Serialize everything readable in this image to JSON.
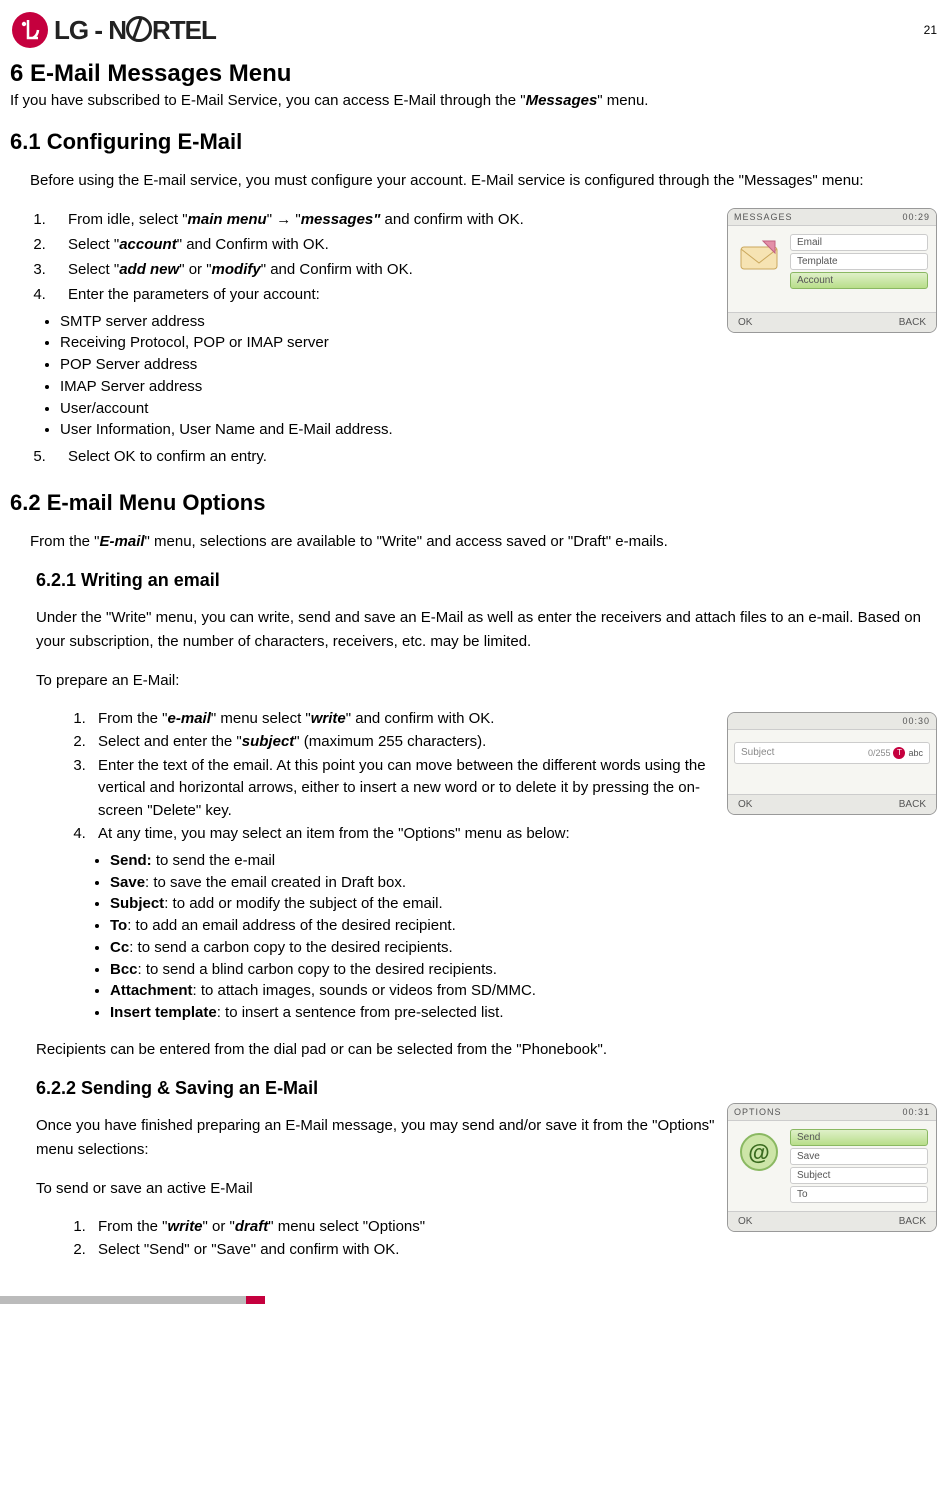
{
  "page_number": "21",
  "logo_text": "LG - NORTEL",
  "h1": "6   E-Mail Messages Menu",
  "intro_1a": "If you have subscribed to E-Mail Service, you can access E-Mail through the \"",
  "intro_1b": "Messages",
  "intro_1c": "\" menu.",
  "h2_61": "6.1     Configuring E-Mail",
  "p61": "Before using the E-mail service, you must configure your account.  E-Mail service is configured through the \"Messages\" menu:",
  "ol61": {
    "li1a": "From idle, select \"",
    "li1b": "main menu",
    "li1c": "\" → \"",
    "li1d": "messages\"",
    "li1e": " and confirm with OK.",
    "li2a": "Select \"",
    "li2b": "account",
    "li2c": "\" and Confirm with OK.",
    "li3a": "Select \"",
    "li3b": "add new",
    "li3c": "\" or \"",
    "li3d": "modify",
    "li3e": "\" and Confirm with OK.",
    "li4": "Enter the parameters of your account:",
    "li5": "Select OK to confirm an entry."
  },
  "ul61": [
    "SMTP server address",
    "Receiving Protocol, POP or IMAP server",
    "POP Server address",
    "IMAP Server address",
    "User/account",
    "User Information, User Name and E-Mail address."
  ],
  "screen1": {
    "title": "MESSAGES",
    "time": "00:29",
    "items": [
      "Email",
      "Template",
      "Account"
    ],
    "selected": 2,
    "ok": "OK",
    "back": "BACK"
  },
  "h2_62": "6.2     E-mail Menu Options",
  "p62a": "From the \"",
  "p62b": "E-mail",
  "p62c": "\" menu, selections are available to \"Write\" and access saved or \"Draft\" e-mails.",
  "h3_621": "6.2.1    Writing an email",
  "p621_1": "Under the \"Write\" menu, you can write, send and save an E-Mail as well as enter the receivers and attach files to an e-mail.  Based on your subscription, the number of characters, receivers, etc. may be limited.",
  "p621_2": "To prepare an E-Mail:",
  "ol621": {
    "li1a": "From the \"",
    "li1b": "e-mail",
    "li1c": "\" menu select \"",
    "li1d": "write",
    "li1e": "\" and confirm with OK.",
    "li2a": "Select and enter the \"",
    "li2b": "subject",
    "li2c": "\" (maximum 255 characters).",
    "li3": "Enter the text of the email. At this point you can move between the different words using the vertical and horizontal arrows, either to insert a new word or to delete it by pressing the on-screen \"Delete\" key.",
    "li4": "At any time, you may select an item from the \"Options\" menu as below:"
  },
  "ul621": [
    {
      "b": "Send:",
      "t": " to send the e-mail"
    },
    {
      "b": "Save",
      "t": ": to save the email created in Draft box."
    },
    {
      "b": "Subject",
      "t": ": to add or modify the subject of the email."
    },
    {
      "b": "To",
      "t": ": to add an email address of the desired recipient."
    },
    {
      "b": "Cc",
      "t": ": to send a carbon copy to the desired recipients."
    },
    {
      "b": "Bcc",
      "t": ": to send a blind carbon copy to the desired recipients."
    },
    {
      "b": "Attachment",
      "t": ": to attach images, sounds or videos from SD/MMC."
    },
    {
      "b": "Insert template",
      "t": ": to insert a sentence from pre-selected list."
    }
  ],
  "screen2": {
    "title": "",
    "time": "00:30",
    "subject_label": "Subject",
    "counter": "0/255",
    "mode": "abc",
    "ok": "OK",
    "back": "BACK"
  },
  "p621_3": "Recipients can be entered from the dial pad or can be selected from the \"Phonebook\".",
  "h3_622": "6.2.2    Sending & Saving an E-Mail",
  "p622_1": "Once you have finished preparing an E-Mail message, you may send and/or save it from the \"Options\" menu selections:",
  "p622_2": "To send or save an active E-Mail",
  "ol622": {
    "li1a": "From the \"",
    "li1b": "write",
    "li1c": "\" or \"",
    "li1d": "draft",
    "li1e": "\" menu select \"Options\"",
    "li2": "Select \"Send\" or \"Save\" and confirm with OK."
  },
  "screen3": {
    "title": "OPTIONS",
    "time": "00:31",
    "items": [
      "Send",
      "Save",
      "Subject",
      "To"
    ],
    "selected": 0,
    "ok": "OK",
    "back": "BACK"
  }
}
